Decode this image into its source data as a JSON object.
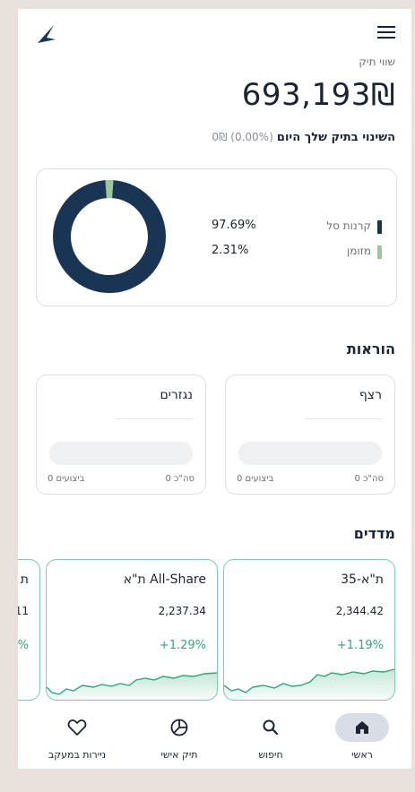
{
  "header": {
    "logo_icon": "arrow-logo-icon",
    "menu_icon": "hamburger-menu-icon"
  },
  "portfolio": {
    "label": "שווי תיק",
    "value": "693,193₪",
    "change_label": "השינוי בתיק שלך היום",
    "change_value": "(0.00%) 0₪"
  },
  "allocation": {
    "items": [
      {
        "name": "קרנות סל",
        "percent": "97.69%",
        "fraction": 0.9769,
        "color": "#1a3554"
      },
      {
        "name": "מזומן",
        "percent": "2.31%",
        "fraction": 0.0231,
        "color": "#9cc79a"
      }
    ]
  },
  "orders": {
    "title": "הוראות",
    "cards": [
      {
        "title": "רצף",
        "total": "0 סה\"כ",
        "executions": "0 ביצועים"
      },
      {
        "title": "נגזרים",
        "total": "0 סה\"כ",
        "executions": "0 ביצועים"
      }
    ]
  },
  "indices": {
    "title": "מדדים",
    "cards": [
      {
        "name": "ת\"א-35",
        "value": "2,344.42",
        "change": "+1.19%"
      },
      {
        "name": "ת\"א All-Share",
        "value": "2,237.34",
        "change": "+1.29%"
      },
      {
        "name": "ת",
        "value": "11",
        "change": "%"
      }
    ]
  },
  "nav": [
    {
      "label": "ראשי",
      "icon": "home-icon",
      "active": true
    },
    {
      "label": "חיפוש",
      "icon": "search-icon"
    },
    {
      "label": "תיק אישי",
      "icon": "portfolio-pie-icon"
    },
    {
      "label": "ניירות במעקב",
      "icon": "heart-icon"
    }
  ],
  "colors": {
    "accent_green": "#2fa77b",
    "navy": "#1a3554",
    "card_border": "#7ec9a8"
  }
}
